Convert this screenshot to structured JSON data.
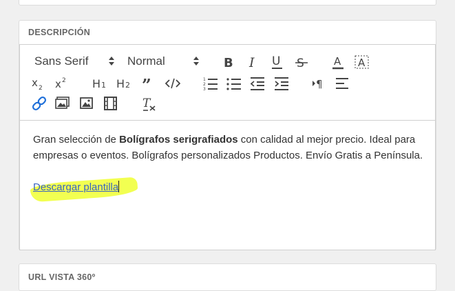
{
  "sections": {
    "description_title": "DESCRIPCIÓN",
    "url360_title": "URL VISTA 360º"
  },
  "toolbar": {
    "font_picker": "Sans Serif",
    "size_picker": "Normal",
    "buttons": [
      "bold",
      "italic",
      "underline",
      "strike",
      "color",
      "background",
      "subscript",
      "superscript",
      "header-1",
      "header-2",
      "blockquote",
      "code-block",
      "list-ordered",
      "list-bullet",
      "indent-decrease",
      "indent-increase",
      "direction-rtl",
      "align",
      "link",
      "image-gallery",
      "image",
      "video",
      "clean"
    ]
  },
  "content": {
    "p1_before": "Gran selección de ",
    "p1_bold": "Bolígrafos serigrafiados",
    "p1_after": " con calidad al mejor precio. Ideal para empresas o eventos. Bolígrafos personalizados Productos. Envío Gratis a Península.",
    "link_text": "Descargar plantilla"
  },
  "colors": {
    "highlight": "#f0ff33",
    "link": "#3a64c0",
    "active_icon": "#1e6fd9"
  }
}
